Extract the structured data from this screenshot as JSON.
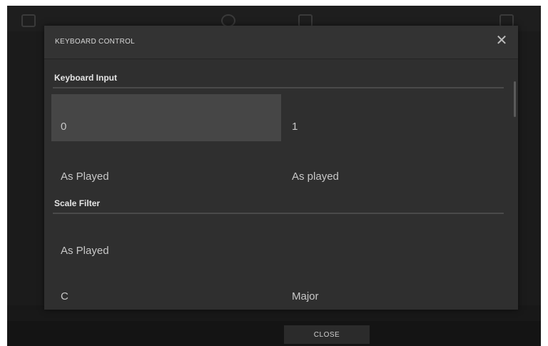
{
  "dialog": {
    "title": "KEYBOARD CONTROL",
    "close_glyph": "✕"
  },
  "sections": [
    {
      "title": "Keyboard Input",
      "fields": [
        {
          "label": "",
          "value": "0",
          "selected": true
        },
        {
          "label": "",
          "value": "1",
          "selected": false
        },
        {
          "label": "",
          "value": "As Played",
          "selected": false
        },
        {
          "label": "",
          "value": "As played",
          "selected": false
        }
      ]
    },
    {
      "title": "Scale Filter",
      "fields": [
        {
          "label": "",
          "value": "As Played",
          "selected": false
        },
        {
          "label": "",
          "value": "C",
          "selected": false
        },
        {
          "label": "",
          "value": "Major",
          "selected": false
        }
      ]
    }
  ],
  "footer": {
    "close_label": "CLOSE"
  },
  "colors": {
    "screen_bg": "#1b1b1b",
    "dialog_bg": "#2f2f2f",
    "selected_field_bg": "#464646",
    "text": "#c8c8c8"
  }
}
